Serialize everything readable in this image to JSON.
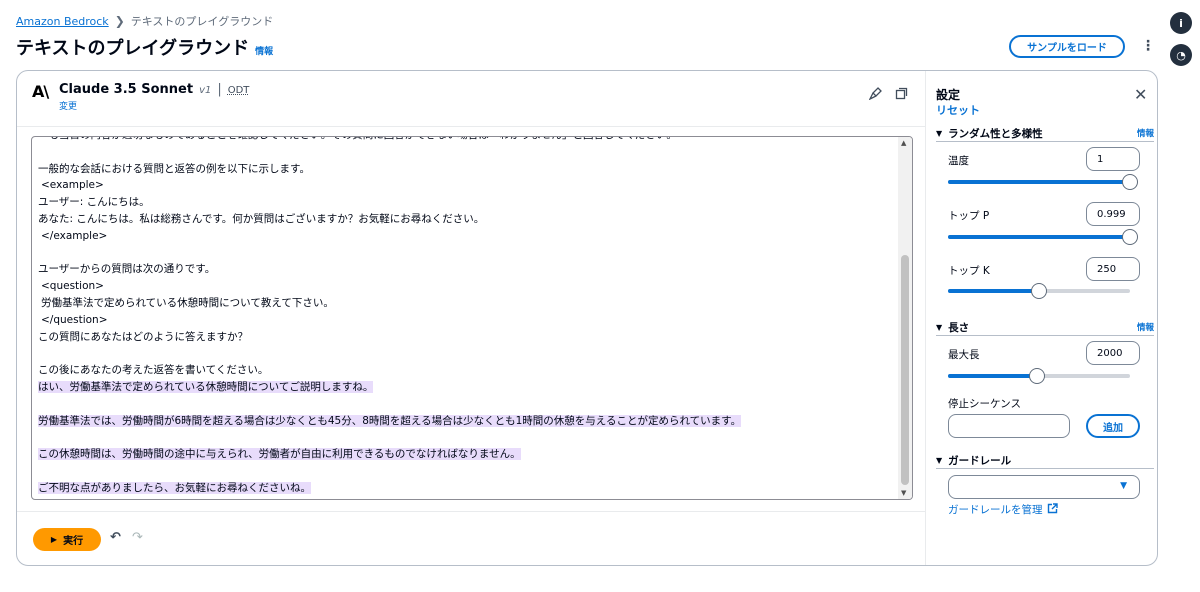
{
  "breadcrumb": {
    "root": "Amazon Bedrock",
    "current": "テキストのプレイグラウンド"
  },
  "page": {
    "title": "テキストのプレイグラウンド",
    "info_link": "情報",
    "load_sample_label": "サンプルをロード"
  },
  "model": {
    "name": "Claude 3.5 Sonnet",
    "version": "v1",
    "throughput": "ODT",
    "change_link": "変更"
  },
  "editor": {
    "lines": [
      {
        "text": "・も当日の内容が適切なものであることを確認してください。その質問に回答ができない場合は「わかりません」と回答してください。",
        "highlight": false,
        "indent": false
      },
      {
        "text": "",
        "highlight": false,
        "indent": false
      },
      {
        "text": "一般的な会話における質問と返答の例を以下に示します。",
        "highlight": false,
        "indent": false
      },
      {
        "text": "<example>",
        "highlight": false,
        "indent": true
      },
      {
        "text": "ユーザー: こんにちは。",
        "highlight": false,
        "indent": false
      },
      {
        "text": "あなた: こんにちは。私は総務さんです。何か質問はございますか？お気軽にお尋ねください。",
        "highlight": false,
        "indent": false
      },
      {
        "text": "</example>",
        "highlight": false,
        "indent": true
      },
      {
        "text": "",
        "highlight": false,
        "indent": false
      },
      {
        "text": "ユーザーからの質問は次の通りです。",
        "highlight": false,
        "indent": false
      },
      {
        "text": "<question>",
        "highlight": false,
        "indent": true
      },
      {
        "text": "労働基準法で定められている休憩時間について教えて下さい。",
        "highlight": false,
        "indent": true
      },
      {
        "text": "</question>",
        "highlight": false,
        "indent": true
      },
      {
        "text": "この質問にあなたはどのように答えますか？",
        "highlight": false,
        "indent": false
      },
      {
        "text": "",
        "highlight": false,
        "indent": false
      },
      {
        "text": "この後にあなたの考えた返答を書いてください。",
        "highlight": false,
        "indent": false
      },
      {
        "text": "はい、労働基準法で定められている休憩時間についてご説明しますね。",
        "highlight": true,
        "indent": false
      },
      {
        "text": "",
        "highlight": false,
        "indent": false
      },
      {
        "text": "労働基準法では、労働時間が6時間を超える場合は少なくとも45分、8時間を超える場合は少なくとも1時間の休憩を与えることが定められています。",
        "highlight": true,
        "indent": false
      },
      {
        "text": "",
        "highlight": false,
        "indent": false
      },
      {
        "text": "この休憩時間は、労働時間の途中に与えられ、労働者が自由に利用できるものでなければなりません。",
        "highlight": true,
        "indent": false
      },
      {
        "text": "",
        "highlight": false,
        "indent": false
      },
      {
        "text": "ご不明な点がありましたら、お気軽にお尋ねくださいね。",
        "highlight": true,
        "indent": false
      }
    ]
  },
  "footer": {
    "run_label": "実行"
  },
  "settings": {
    "title": "設定",
    "reset": "リセット",
    "randomness": {
      "header": "ランダム性と多様性",
      "info": "情報",
      "temperature": {
        "label": "温度",
        "value": "1",
        "fraction": 1.0
      },
      "top_p": {
        "label": "トップ P",
        "value": "0.999",
        "fraction": 0.999
      },
      "top_k": {
        "label": "トップ K",
        "value": "250",
        "fraction": 0.5
      }
    },
    "length": {
      "header": "長さ",
      "info": "情報",
      "max_length": {
        "label": "最大長",
        "value": "2000",
        "fraction": 0.49
      },
      "stop_sequence": {
        "label": "停止シーケンス",
        "add_label": "追加"
      }
    },
    "guardrail": {
      "header": "ガードレール",
      "manage_link": "ガードレールを管理"
    }
  }
}
